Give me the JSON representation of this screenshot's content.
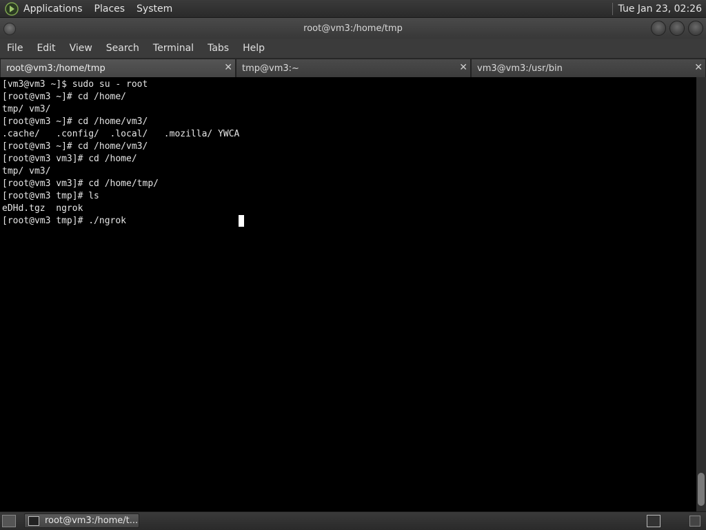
{
  "top_panel": {
    "menus": [
      "Applications",
      "Places",
      "System"
    ],
    "clock": "Tue Jan 23, 02:26"
  },
  "window": {
    "title": "root@vm3:/home/tmp"
  },
  "menubar": [
    "File",
    "Edit",
    "View",
    "Search",
    "Terminal",
    "Tabs",
    "Help"
  ],
  "tabs": [
    {
      "label": "root@vm3:/home/tmp",
      "active": true
    },
    {
      "label": "tmp@vm3:~",
      "active": false
    },
    {
      "label": "vm3@vm3:/usr/bin",
      "active": false
    }
  ],
  "terminal": {
    "lines": [
      "[vm3@vm3 ~]$ sudo su - root",
      "[root@vm3 ~]# cd /home/",
      "tmp/ vm3/",
      "[root@vm3 ~]# cd /home/vm3/",
      ".cache/   .config/  .local/   .mozilla/ YWCA",
      "[root@vm3 ~]# cd /home/vm3/",
      "[root@vm3 vm3]# cd /home/",
      "tmp/ vm3/",
      "[root@vm3 vm3]# cd /home/tmp/",
      "[root@vm3 tmp]# ls",
      "eDHd.tgz  ngrok",
      "[root@vm3 tmp]# ./ngrok"
    ]
  },
  "taskbar": {
    "task_label": "root@vm3:/home/t..."
  },
  "icons": {
    "logo": "gnome-foot-icon",
    "close": "close-icon",
    "terminal": "terminal-icon"
  }
}
